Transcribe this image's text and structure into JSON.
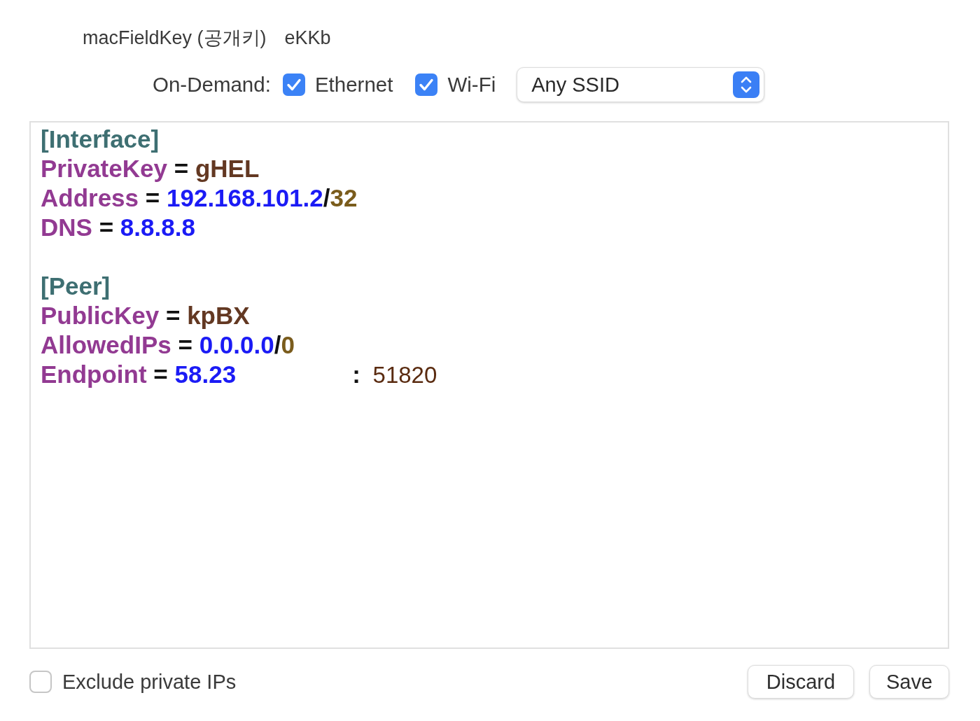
{
  "public_key": {
    "label": "macFieldKey (공개키)",
    "value": "eKKb"
  },
  "on_demand": {
    "label": "On-Demand:",
    "options": [
      {
        "label": "Ethernet",
        "checked": true
      },
      {
        "label": "Wi-Fi",
        "checked": true
      }
    ],
    "ssid": {
      "value": "Any SSID"
    }
  },
  "editor": {
    "lines": [
      {
        "kind": "section",
        "text": "[Interface]"
      },
      {
        "kind": "pair",
        "tokens": [
          {
            "kind": "key",
            "text": "PrivateKey"
          },
          {
            "kind": "op",
            "text": "="
          },
          {
            "kind": "string",
            "text": "gHEL"
          }
        ]
      },
      {
        "kind": "pair",
        "tokens": [
          {
            "kind": "key",
            "text": "Address"
          },
          {
            "kind": "op",
            "text": "="
          },
          {
            "kind": "ip",
            "text": "192.168.101.2"
          },
          {
            "kind": "slash",
            "text": "/"
          },
          {
            "kind": "cidr",
            "text": "32"
          }
        ]
      },
      {
        "kind": "pair",
        "tokens": [
          {
            "kind": "key",
            "text": "DNS"
          },
          {
            "kind": "op",
            "text": "="
          },
          {
            "kind": "ip",
            "text": "8.8.8.8"
          }
        ]
      },
      {
        "kind": "blank"
      },
      {
        "kind": "section",
        "text": "[Peer]"
      },
      {
        "kind": "pair",
        "tokens": [
          {
            "kind": "key",
            "text": "PublicKey"
          },
          {
            "kind": "op",
            "text": "="
          },
          {
            "kind": "string",
            "text": "kpBX"
          }
        ]
      },
      {
        "kind": "pair",
        "tokens": [
          {
            "kind": "key",
            "text": "AllowedIPs"
          },
          {
            "kind": "op",
            "text": "="
          },
          {
            "kind": "ip",
            "text": "0.0.0.0"
          },
          {
            "kind": "slash",
            "text": "/"
          },
          {
            "kind": "cidr",
            "text": "0"
          }
        ]
      },
      {
        "kind": "pair",
        "tokens": [
          {
            "kind": "key",
            "text": "Endpoint"
          },
          {
            "kind": "op",
            "text": "="
          },
          {
            "kind": "ip",
            "text": "58.23"
          },
          {
            "kind": "colon",
            "text": ":"
          },
          {
            "kind": "port",
            "text": "51820"
          }
        ]
      }
    ]
  },
  "exclude_private_ips": {
    "label": "Exclude private IPs",
    "checked": false
  },
  "buttons": [
    {
      "label": "Discard"
    },
    {
      "label": "Save"
    }
  ]
}
